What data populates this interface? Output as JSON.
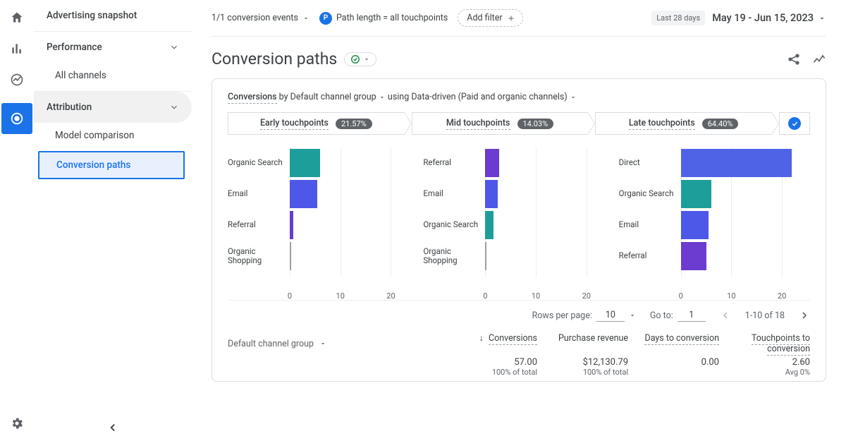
{
  "rail": {
    "home": "home-icon",
    "reports": "bar-chart-icon",
    "explore": "trend-icon",
    "attribution": "target-icon",
    "settings": "gear-icon"
  },
  "sidebar": {
    "snapshot": "Advertising snapshot",
    "performance": "Performance",
    "all_channels": "All channels",
    "attribution": "Attribution",
    "model_comparison": "Model comparison",
    "conversion_paths": "Conversion paths"
  },
  "filters": {
    "events": "1/1 conversion events",
    "path_badge": "P",
    "path_text": "Path length = all touchpoints",
    "add_filter": "Add filter",
    "last28": "Last 28 days",
    "date_range": "May 19 - Jun 15, 2023"
  },
  "title": "Conversion paths",
  "card": {
    "conversions": "Conversions",
    "by": " by Default channel group",
    "using": "  using Data-driven (Paid and organic channels)",
    "steps": [
      {
        "label": "Early touchpoints",
        "pct": "21.57%"
      },
      {
        "label": "Mid touchpoints",
        "pct": "14.03%"
      },
      {
        "label": "Late touchpoints",
        "pct": "64.40%"
      }
    ]
  },
  "chart_data": [
    {
      "type": "bar",
      "title": "Early touchpoints",
      "xlim": [
        0,
        25
      ],
      "ticks": [
        0,
        10,
        20
      ],
      "series": [
        {
          "name": "Organic Search",
          "value": 6,
          "color": "#1e9e9a"
        },
        {
          "name": "Email",
          "value": 5.5,
          "color": "#4d57e8"
        },
        {
          "name": "Referral",
          "value": 0.7,
          "color": "#6b3ccf"
        },
        {
          "name": "Organic Shopping",
          "value": 0.3,
          "color": "#9aa0a6"
        }
      ]
    },
    {
      "type": "bar",
      "title": "Mid touchpoints",
      "xlim": [
        0,
        25
      ],
      "ticks": [
        0,
        10,
        20
      ],
      "series": [
        {
          "name": "Referral",
          "value": 2.8,
          "color": "#6b3ccf"
        },
        {
          "name": "Email",
          "value": 2.5,
          "color": "#4d57e8"
        },
        {
          "name": "Organic Search",
          "value": 1.6,
          "color": "#1e9e9a"
        },
        {
          "name": "Organic Shopping",
          "value": 0.2,
          "color": "#9aa0a6"
        }
      ]
    },
    {
      "type": "bar",
      "title": "Late touchpoints",
      "xlim": [
        0,
        25
      ],
      "ticks": [
        0,
        10,
        20
      ],
      "series": [
        {
          "name": "Direct",
          "value": 22,
          "color": "#4f63e6"
        },
        {
          "name": "Organic Search",
          "value": 6,
          "color": "#1e9e9a"
        },
        {
          "name": "Email",
          "value": 5.5,
          "color": "#4d57e8"
        },
        {
          "name": "Referral",
          "value": 5,
          "color": "#6b3ccf"
        }
      ]
    }
  ],
  "pager": {
    "rows_label": "Rows per page:",
    "rows_value": "10",
    "goto_label": "Go to:",
    "goto_value": "1",
    "range": "1-10 of 18"
  },
  "table": {
    "group_label": "Default channel group",
    "cols": {
      "conversions": "Conversions",
      "revenue": "Purchase revenue",
      "days": "Days to conversion",
      "touchpoints": "Touchpoints to conversion"
    },
    "row": {
      "conversions": "57.00",
      "revenue": "$12,130.79",
      "days": "0.00",
      "touchpoints": "2.60"
    },
    "sub": {
      "conversions": "100% of total",
      "revenue": "100% of total",
      "days": "",
      "touchpoints": "Avg 0%"
    }
  }
}
